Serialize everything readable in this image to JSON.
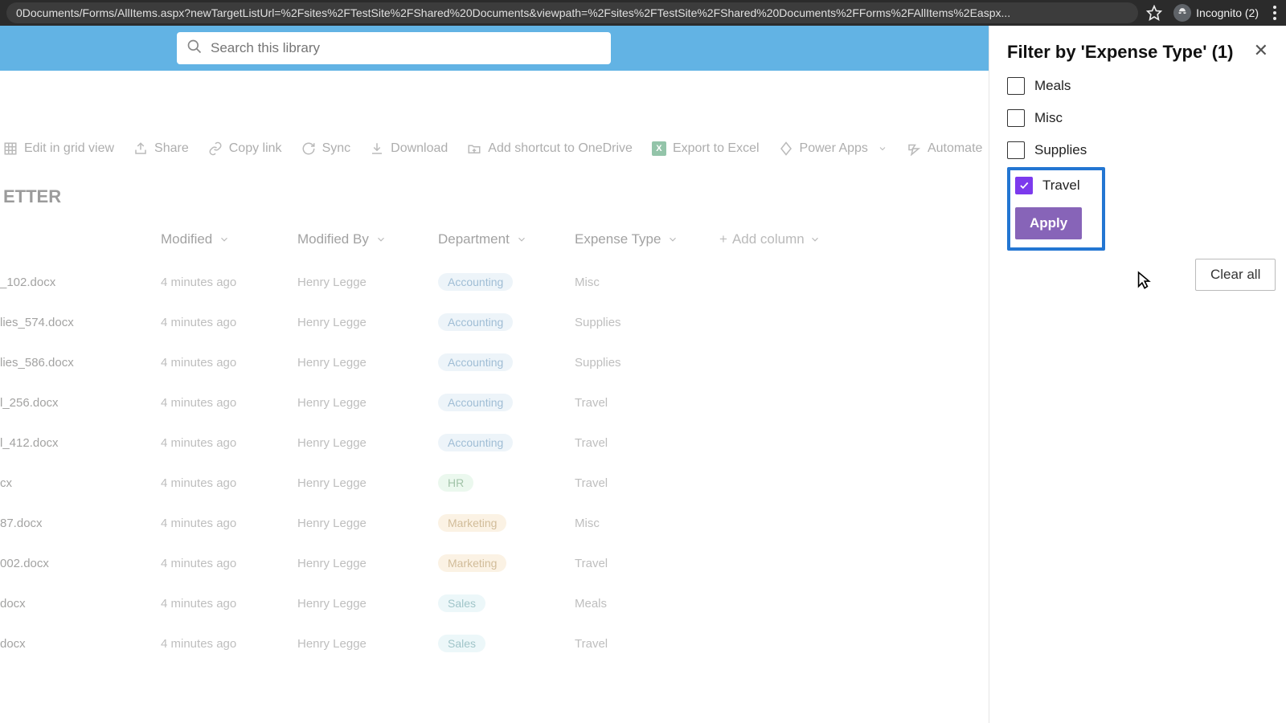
{
  "browser": {
    "url": "0Documents/Forms/AllItems.aspx?newTargetListUrl=%2Fsites%2FTestSite%2FShared%20Documents&viewpath=%2Fsites%2FTestSite%2FShared%20Documents%2FForms%2FAllItems%2Easpx...",
    "incognito_label": "Incognito (2)"
  },
  "search": {
    "placeholder": "Search this library"
  },
  "commands": {
    "grid": "Edit in grid view",
    "share": "Share",
    "copy": "Copy link",
    "sync": "Sync",
    "download": "Download",
    "shortcut": "Add shortcut to OneDrive",
    "excel": "Export to Excel",
    "power": "Power Apps",
    "automate": "Automate"
  },
  "page_title": "ETTER",
  "columns": {
    "modified": "Modified",
    "modified_by": "Modified By",
    "department": "Department",
    "expense_type": "Expense Type",
    "add": "Add column"
  },
  "rows": [
    {
      "name": "_102.docx",
      "modified": "4 minutes ago",
      "by": "Henry Legge",
      "dept": "Accounting",
      "dept_class": "pill-accounting",
      "exp": "Misc"
    },
    {
      "name": "lies_574.docx",
      "modified": "4 minutes ago",
      "by": "Henry Legge",
      "dept": "Accounting",
      "dept_class": "pill-accounting",
      "exp": "Supplies"
    },
    {
      "name": "lies_586.docx",
      "modified": "4 minutes ago",
      "by": "Henry Legge",
      "dept": "Accounting",
      "dept_class": "pill-accounting",
      "exp": "Supplies"
    },
    {
      "name": "l_256.docx",
      "modified": "4 minutes ago",
      "by": "Henry Legge",
      "dept": "Accounting",
      "dept_class": "pill-accounting",
      "exp": "Travel"
    },
    {
      "name": "l_412.docx",
      "modified": "4 minutes ago",
      "by": "Henry Legge",
      "dept": "Accounting",
      "dept_class": "pill-accounting",
      "exp": "Travel"
    },
    {
      "name": "cx",
      "modified": "4 minutes ago",
      "by": "Henry Legge",
      "dept": "HR",
      "dept_class": "pill-hr",
      "exp": "Travel"
    },
    {
      "name": "87.docx",
      "modified": "4 minutes ago",
      "by": "Henry Legge",
      "dept": "Marketing",
      "dept_class": "pill-marketing",
      "exp": "Misc"
    },
    {
      "name": "002.docx",
      "modified": "4 minutes ago",
      "by": "Henry Legge",
      "dept": "Marketing",
      "dept_class": "pill-marketing",
      "exp": "Travel"
    },
    {
      "name": "docx",
      "modified": "4 minutes ago",
      "by": "Henry Legge",
      "dept": "Sales",
      "dept_class": "pill-sales",
      "exp": "Meals"
    },
    {
      "name": "docx",
      "modified": "4 minutes ago",
      "by": "Henry Legge",
      "dept": "Sales",
      "dept_class": "pill-sales",
      "exp": "Travel"
    }
  ],
  "filter": {
    "title": "Filter by 'Expense Type' (1)",
    "options": [
      {
        "label": "Meals",
        "checked": false
      },
      {
        "label": "Misc",
        "checked": false
      },
      {
        "label": "Supplies",
        "checked": false
      },
      {
        "label": "Travel",
        "checked": true
      }
    ],
    "apply": "Apply",
    "clear": "Clear all"
  }
}
